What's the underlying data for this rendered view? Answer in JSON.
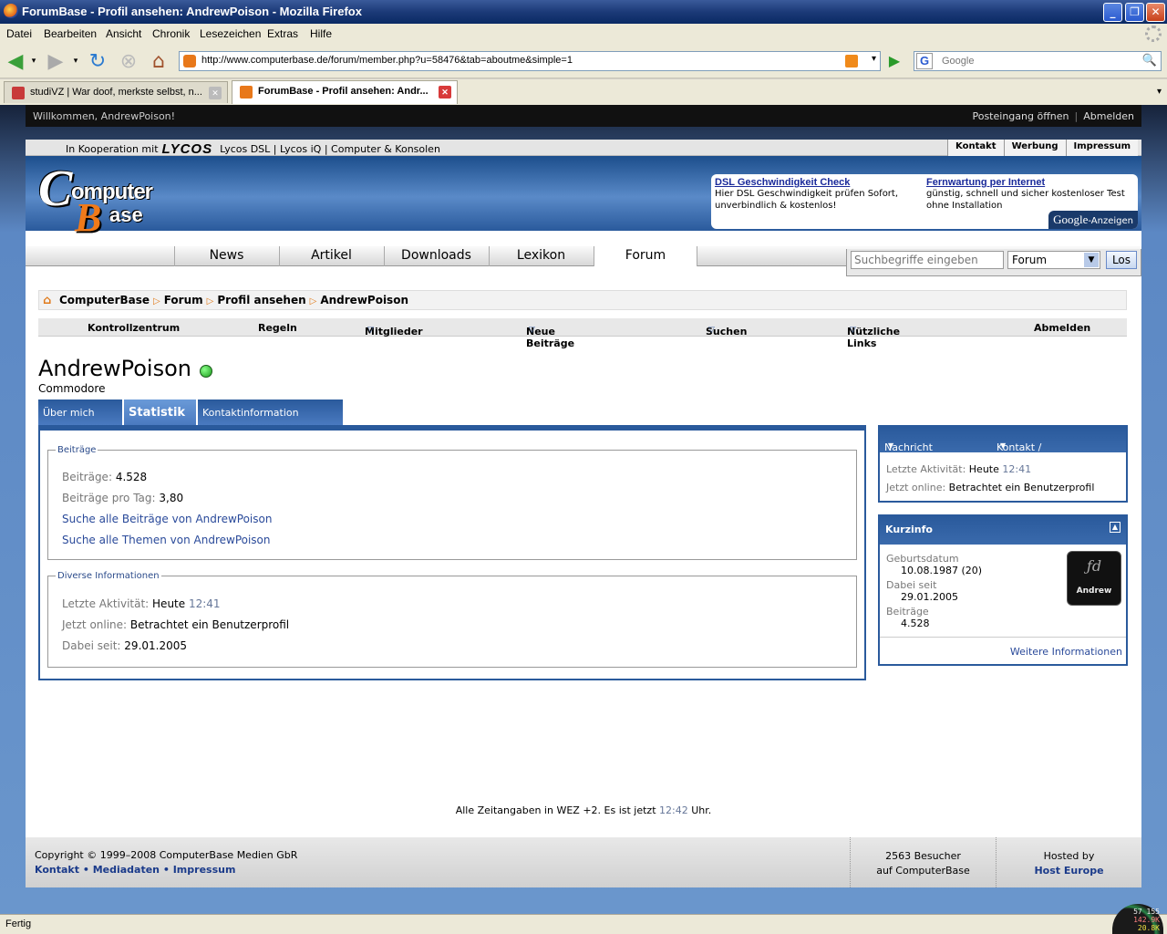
{
  "window": {
    "title": "ForumBase - Profil ansehen: AndrewPoison - Mozilla Firefox"
  },
  "menu": [
    "Datei",
    "Bearbeiten",
    "Ansicht",
    "Chronik",
    "Lesezeichen",
    "Extras",
    "Hilfe"
  ],
  "toolbar": {
    "url": "http://www.computerbase.de/forum/member.php?u=58476&tab=aboutme&simple=1",
    "search_placeholder": "Google"
  },
  "tabs": [
    {
      "label": "studiVZ | War doof, merkste selbst, n..."
    },
    {
      "label": "ForumBase - Profil ansehen: Andr..."
    }
  ],
  "welcome": {
    "text": "Willkommen, AndrewPoison!",
    "inbox": "Posteingang öffnen",
    "logout": "Abmelden"
  },
  "topstrip": {
    "koop": "In Kooperation mit",
    "brand": "LYCOS",
    "links": "Lycos DSL | Lycos iQ | Computer & Konsolen",
    "right": [
      "Kontakt",
      "Werbung",
      "Impressum"
    ]
  },
  "logo": {
    "c": "C",
    "omputer": "omputer",
    "b": "B",
    "ase": "ase"
  },
  "ads": [
    {
      "title": "DSL Geschwindigkeit Check",
      "desc": "Hier DSL Geschwindigkeit prüfen Sofort, unverbindlich & kostenlos!"
    },
    {
      "title": "Fernwartung per Internet",
      "desc": "günstig, schnell und sicher kostenloser Test ohne Installation"
    }
  ],
  "google_ads": {
    "google": "Google",
    "label": "-Anzeigen"
  },
  "mainnav": [
    "News",
    "Artikel",
    "Downloads",
    "Lexikon",
    "Forum"
  ],
  "sitesearch": {
    "placeholder": "Suchbegriffe eingeben",
    "scope": "Forum",
    "button": "Los"
  },
  "breadcrumb": [
    "ComputerBase",
    "Forum",
    "Profil ansehen",
    "AndrewPoison"
  ],
  "forumnav": [
    "Kontrollzentrum",
    "Regeln",
    "Mitglieder",
    "Neue Beiträge",
    "Suchen",
    "Nützliche Links",
    "Abmelden"
  ],
  "profile": {
    "name": "AndrewPoison",
    "title": "Commodore",
    "tabs": [
      "Über mich",
      "Statistik",
      "Kontaktinformation"
    ]
  },
  "stats": {
    "beitraege_legend": "Beiträge",
    "posts_label": "Beiträge:",
    "posts_value": "4.528",
    "perday_label": "Beiträge pro Tag:",
    "perday_value": "3,80",
    "search_posts": "Suche alle Beiträge von AndrewPoison",
    "search_threads": "Suche alle Themen von AndrewPoison",
    "diverse_legend": "Diverse Informationen",
    "last_label": "Letzte Aktivität:",
    "last_day": "Heute",
    "last_time": "12:41",
    "online_label": "Jetzt online:",
    "online_value": "Betrachtet ein Benutzerprofil",
    "joined_label": "Dabei seit:",
    "joined_value": "29.01.2005"
  },
  "contactbox": {
    "send": "Nachricht senden",
    "contact": "Kontakt / Ignorieren",
    "last_label": "Letzte Aktivität:",
    "last_day": "Heute",
    "last_time": "12:41",
    "online_label": "Jetzt online:",
    "online_value": "Betrachtet ein Benutzerprofil"
  },
  "kurzinfo": {
    "title": "Kurzinfo",
    "birthday_label": "Geburtsdatum",
    "birthday_value": "10.08.1987 (20)",
    "joined_label": "Dabei seit",
    "joined_value": "29.01.2005",
    "posts_label": "Beiträge",
    "posts_value": "4.528",
    "avatar_name": "Andrew",
    "more": "Weitere Informationen"
  },
  "timeline": {
    "prefix": "Alle Zeitangaben in WEZ +2. Es ist jetzt",
    "time": "12:42",
    "suffix": "Uhr."
  },
  "footer": {
    "copyright": "Copyright © 1999–2008 ComputerBase Medien GbR",
    "links": [
      "Kontakt",
      "Mediadaten",
      "Impressum"
    ],
    "visitors_1": "2563 Besucher",
    "visitors_2": "auf ComputerBase",
    "hosted_by": "Hosted by",
    "host": "Host Europe"
  },
  "status": {
    "text": "Fertig",
    "meter": [
      "57 155",
      "142.9K",
      "20.8K"
    ]
  }
}
